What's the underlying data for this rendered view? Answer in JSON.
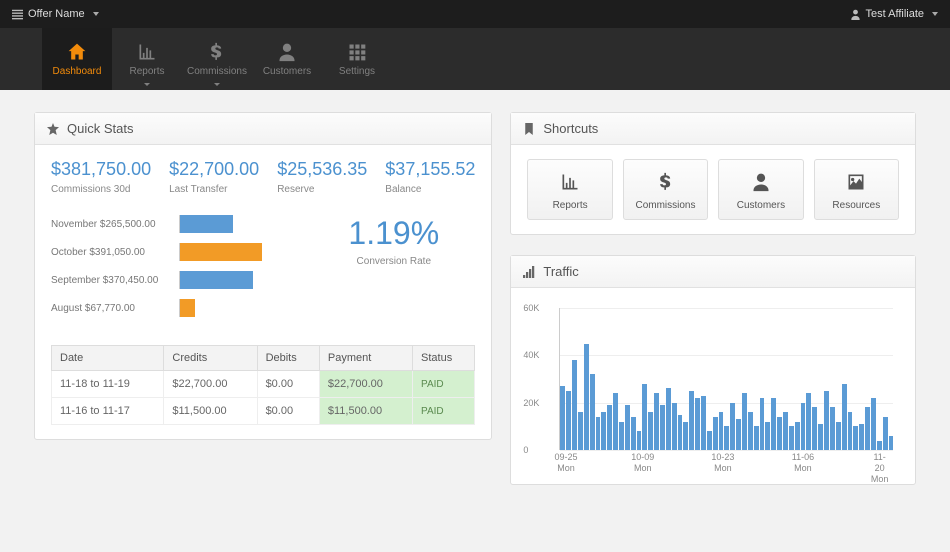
{
  "topbar": {
    "brand": "Offer Name",
    "user": "Test Affiliate"
  },
  "nav": [
    {
      "label": "Dashboard",
      "icon": "home",
      "active": true,
      "dropdown": false
    },
    {
      "label": "Reports",
      "icon": "bar-chart",
      "active": false,
      "dropdown": true
    },
    {
      "label": "Commissions",
      "icon": "dollar",
      "active": false,
      "dropdown": true
    },
    {
      "label": "Customers",
      "icon": "user",
      "active": false,
      "dropdown": false
    },
    {
      "label": "Settings",
      "icon": "grid",
      "active": false,
      "dropdown": false
    }
  ],
  "panels": {
    "quick_stats_title": "Quick Stats",
    "shortcuts_title": "Shortcuts",
    "traffic_title": "Traffic"
  },
  "stats": [
    {
      "value": "$381,750.00",
      "label": "Commissions 30d"
    },
    {
      "value": "$22,700.00",
      "label": "Last Transfer"
    },
    {
      "value": "$25,536.35",
      "label": "Reserve"
    },
    {
      "value": "$37,155.52",
      "label": "Balance"
    }
  ],
  "hbars": [
    {
      "label": "November $265,500.00",
      "pct": 40,
      "color": "#5b9bd5"
    },
    {
      "label": "October $391,050.00",
      "pct": 62,
      "color": "#f29b26"
    },
    {
      "label": "September $370,450.00",
      "pct": 55,
      "color": "#5b9bd5"
    },
    {
      "label": "August $67,770.00",
      "pct": 11,
      "color": "#f29b26"
    }
  ],
  "conversion": {
    "value": "1.19%",
    "label": "Conversion Rate"
  },
  "table": {
    "headers": [
      "Date",
      "Credits",
      "Debits",
      "Payment",
      "Status"
    ],
    "rows": [
      {
        "date": "11-18 to 11-19",
        "credits": "$22,700.00",
        "debits": "$0.00",
        "payment": "$22,700.00",
        "status": "PAID"
      },
      {
        "date": "11-16 to 11-17",
        "credits": "$11,500.00",
        "debits": "$0.00",
        "payment": "$11,500.00",
        "status": "PAID"
      }
    ]
  },
  "shortcuts": [
    {
      "label": "Reports",
      "icon": "bar-chart"
    },
    {
      "label": "Commissions",
      "icon": "dollar"
    },
    {
      "label": "Customers",
      "icon": "user"
    },
    {
      "label": "Resources",
      "icon": "image"
    }
  ],
  "chart_data": {
    "type": "bar",
    "title": "Traffic",
    "ylabel": "",
    "ylim": [
      0,
      60000
    ],
    "yticks": [
      0,
      20000,
      40000,
      60000
    ],
    "ytick_labels": [
      "0",
      "20K",
      "40K",
      "60K"
    ],
    "x_ticks": [
      {
        "pos": 0.02,
        "label": "09-25",
        "sub": "Mon"
      },
      {
        "pos": 0.25,
        "label": "10-09",
        "sub": "Mon"
      },
      {
        "pos": 0.49,
        "label": "10-23",
        "sub": "Mon"
      },
      {
        "pos": 0.73,
        "label": "11-06",
        "sub": "Mon"
      },
      {
        "pos": 0.96,
        "label": "11-20",
        "sub": "Mon"
      }
    ],
    "values": [
      27000,
      25000,
      38000,
      16000,
      45000,
      32000,
      14000,
      16000,
      19000,
      24000,
      12000,
      19000,
      14000,
      8000,
      28000,
      16000,
      24000,
      19000,
      26000,
      20000,
      15000,
      12000,
      25000,
      22000,
      23000,
      8000,
      14000,
      16000,
      10000,
      20000,
      13000,
      24000,
      16000,
      10000,
      22000,
      12000,
      22000,
      14000,
      16000,
      10000,
      12000,
      20000,
      24000,
      18000,
      11000,
      25000,
      18000,
      12000,
      28000,
      16000,
      10000,
      11000,
      18000,
      22000,
      4000,
      14000,
      6000
    ]
  }
}
